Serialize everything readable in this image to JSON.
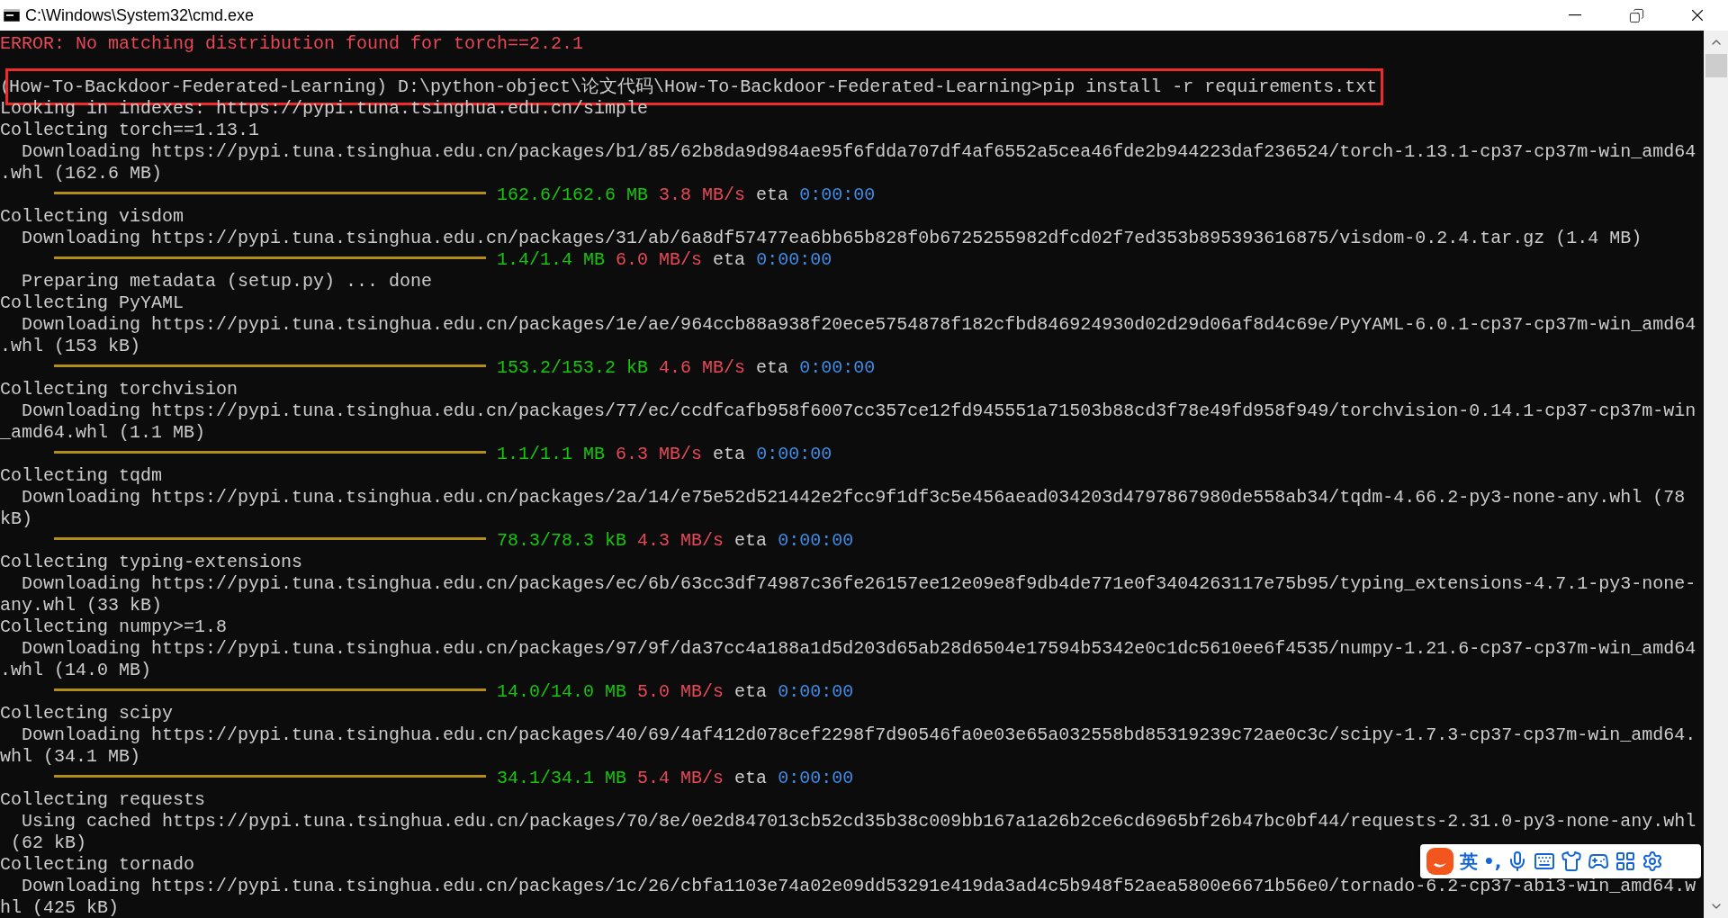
{
  "window": {
    "title": "C:\\Windows\\System32\\cmd.exe"
  },
  "console": {
    "rows": [
      {
        "kind": "text",
        "segments": [
          {
            "kind": "text",
            "text": "ERROR: No matching distribution found for torch==2.2.1",
            "color": "#e74856"
          }
        ]
      },
      {
        "kind": "blank"
      },
      {
        "kind": "text",
        "segments": [
          {
            "kind": "text",
            "text": "(",
            "color": "#cccccc"
          },
          {
            "kind": "text",
            "text": "How-To-Backdoor-Federated-Learning) D:\\python-object\\论文代码\\How-To-Backdoor-Federated-Learning>pip install -r requirements.txt",
            "color": "#cccccc",
            "boxed": true
          }
        ]
      },
      {
        "kind": "text",
        "segments": [
          {
            "kind": "text",
            "text": "Looking in indexes: https://pypi.tuna.tsinghua.edu.cn/simple",
            "color": "#cccccc"
          }
        ]
      },
      {
        "kind": "text",
        "segments": [
          {
            "kind": "text",
            "text": "Collecting torch==1.13.1",
            "color": "#cccccc"
          }
        ]
      },
      {
        "kind": "text",
        "segments": [
          {
            "kind": "text",
            "text": "  Downloading https://pypi.tuna.tsinghua.edu.cn/packages/b1/85/62b8da9d984ae95f6fdda707df4af6552a5cea46fde2b944223daf236524/torch-1.13.1-cp37-cp37m-win_amd64",
            "color": "#cccccc"
          }
        ]
      },
      {
        "kind": "text",
        "segments": [
          {
            "kind": "text",
            "text": ".whl (162.6 MB)",
            "color": "#cccccc"
          }
        ]
      },
      {
        "kind": "progress",
        "level": 1,
        "done": "162.6/162.6 MB",
        "speed": "3.8 MB/s",
        "eta_label": "eta",
        "eta": "0:00:00"
      },
      {
        "kind": "text",
        "segments": [
          {
            "kind": "text",
            "text": "Collecting visdom",
            "color": "#cccccc"
          }
        ]
      },
      {
        "kind": "text",
        "segments": [
          {
            "kind": "text",
            "text": "  Downloading https://pypi.tuna.tsinghua.edu.cn/packages/31/ab/6a8df57477ea6bb65b828f0b6725255982dfcd02f7ed353b895393616875/visdom-0.2.4.tar.gz (1.4 MB)",
            "color": "#cccccc"
          }
        ]
      },
      {
        "kind": "progress",
        "level": 1,
        "done": "1.4/1.4 MB",
        "speed": "6.0 MB/s",
        "eta_label": "eta",
        "eta": "0:00:00"
      },
      {
        "kind": "text",
        "segments": [
          {
            "kind": "text",
            "text": "  Preparing metadata (setup.py) ... done",
            "color": "#cccccc"
          }
        ]
      },
      {
        "kind": "text",
        "segments": [
          {
            "kind": "text",
            "text": "Collecting PyYAML",
            "color": "#cccccc"
          }
        ]
      },
      {
        "kind": "text",
        "segments": [
          {
            "kind": "text",
            "text": "  Downloading https://pypi.tuna.tsinghua.edu.cn/packages/1e/ae/964ccb88a938f20ece5754878f182cfbd846924930d02d29d06af8d4c69e/PyYAML-6.0.1-cp37-cp37m-win_amd64",
            "color": "#cccccc"
          }
        ]
      },
      {
        "kind": "text",
        "segments": [
          {
            "kind": "text",
            "text": ".whl (153 kB)",
            "color": "#cccccc"
          }
        ]
      },
      {
        "kind": "progress",
        "level": 1,
        "done": "153.2/153.2 kB",
        "speed": "4.6 MB/s",
        "eta_label": "eta",
        "eta": "0:00:00"
      },
      {
        "kind": "text",
        "segments": [
          {
            "kind": "text",
            "text": "Collecting torchvision",
            "color": "#cccccc"
          }
        ]
      },
      {
        "kind": "text",
        "segments": [
          {
            "kind": "text",
            "text": "  Downloading https://pypi.tuna.tsinghua.edu.cn/packages/77/ec/ccdfcafb958f6007cc357ce12fd945551a71503b88cd3f78e49fd958f949/torchvision-0.14.1-cp37-cp37m-win",
            "color": "#cccccc"
          }
        ]
      },
      {
        "kind": "text",
        "segments": [
          {
            "kind": "text",
            "text": "_amd64.whl (1.1 MB)",
            "color": "#cccccc"
          }
        ]
      },
      {
        "kind": "progress",
        "level": 1,
        "done": "1.1/1.1 MB",
        "speed": "6.3 MB/s",
        "eta_label": "eta",
        "eta": "0:00:00"
      },
      {
        "kind": "text",
        "segments": [
          {
            "kind": "text",
            "text": "Collecting tqdm",
            "color": "#cccccc"
          }
        ]
      },
      {
        "kind": "text",
        "segments": [
          {
            "kind": "text",
            "text": "  Downloading https://pypi.tuna.tsinghua.edu.cn/packages/2a/14/e75e52d521442e2fcc9f1df3c5e456aead034203d4797867980de558ab34/tqdm-4.66.2-py3-none-any.whl (78",
            "color": "#cccccc"
          }
        ]
      },
      {
        "kind": "text",
        "segments": [
          {
            "kind": "text",
            "text": "kB)",
            "color": "#cccccc"
          }
        ]
      },
      {
        "kind": "progress",
        "level": 1,
        "done": "78.3/78.3 kB",
        "speed": "4.3 MB/s",
        "eta_label": "eta",
        "eta": "0:00:00"
      },
      {
        "kind": "text",
        "segments": [
          {
            "kind": "text",
            "text": "Collecting typing-extensions",
            "color": "#cccccc"
          }
        ]
      },
      {
        "kind": "text",
        "segments": [
          {
            "kind": "text",
            "text": "  Downloading https://pypi.tuna.tsinghua.edu.cn/packages/ec/6b/63cc3df74987c36fe26157ee12e09e8f9db4de771e0f3404263117e75b95/typing_extensions-4.7.1-py3-none-",
            "color": "#cccccc"
          }
        ]
      },
      {
        "kind": "text",
        "segments": [
          {
            "kind": "text",
            "text": "any.whl (33 kB)",
            "color": "#cccccc"
          }
        ]
      },
      {
        "kind": "text",
        "segments": [
          {
            "kind": "text",
            "text": "Collecting numpy>=1.8",
            "color": "#cccccc"
          }
        ]
      },
      {
        "kind": "text",
        "segments": [
          {
            "kind": "text",
            "text": "  Downloading https://pypi.tuna.tsinghua.edu.cn/packages/97/9f/da37cc4a188a1d5d203d65ab28d6504e17594b5342e0c1dc5610ee6f4535/numpy-1.21.6-cp37-cp37m-win_amd64",
            "color": "#cccccc"
          }
        ]
      },
      {
        "kind": "text",
        "segments": [
          {
            "kind": "text",
            "text": ".whl (14.0 MB)",
            "color": "#cccccc"
          }
        ]
      },
      {
        "kind": "progress",
        "level": 1,
        "done": "14.0/14.0 MB",
        "speed": "5.0 MB/s",
        "eta_label": "eta",
        "eta": "0:00:00"
      },
      {
        "kind": "text",
        "segments": [
          {
            "kind": "text",
            "text": "Collecting scipy",
            "color": "#cccccc"
          }
        ]
      },
      {
        "kind": "text",
        "segments": [
          {
            "kind": "text",
            "text": "  Downloading https://pypi.tuna.tsinghua.edu.cn/packages/40/69/4af412d078cef2298f7d90546fa0e03e65a032558bd85319239c72ae0c3c/scipy-1.7.3-cp37-cp37m-win_amd64.",
            "color": "#cccccc"
          }
        ]
      },
      {
        "kind": "text",
        "segments": [
          {
            "kind": "text",
            "text": "whl (34.1 MB)",
            "color": "#cccccc"
          }
        ]
      },
      {
        "kind": "progress",
        "level": 1,
        "done": "34.1/34.1 MB",
        "speed": "5.4 MB/s",
        "eta_label": "eta",
        "eta": "0:00:00"
      },
      {
        "kind": "text",
        "segments": [
          {
            "kind": "text",
            "text": "Collecting requests",
            "color": "#cccccc"
          }
        ]
      },
      {
        "kind": "text",
        "segments": [
          {
            "kind": "text",
            "text": "  Using cached https://pypi.tuna.tsinghua.edu.cn/packages/70/8e/0e2d847013cb52cd35b38c009bb167a1a26b2ce6cd6965bf26b47bc0bf44/requests-2.31.0-py3-none-any.whl",
            "color": "#cccccc"
          }
        ]
      },
      {
        "kind": "text",
        "segments": [
          {
            "kind": "text",
            "text": " (62 kB)",
            "color": "#cccccc"
          }
        ]
      },
      {
        "kind": "text",
        "segments": [
          {
            "kind": "text",
            "text": "Collecting tornado",
            "color": "#cccccc"
          }
        ]
      },
      {
        "kind": "text",
        "segments": [
          {
            "kind": "text",
            "text": "  Downloading https://pypi.tuna.tsinghua.edu.cn/packages/1c/26/cbfa1103e74a02e09dd53291e419da3ad4c5b948f52aea5800e6671b56e0/tornado-6.2-cp37-abi3-win_amd64.w",
            "color": "#cccccc"
          }
        ]
      },
      {
        "kind": "text",
        "segments": [
          {
            "kind": "text",
            "text": "hl (425 kB)",
            "color": "#cccccc"
          }
        ]
      }
    ]
  },
  "ime_toolbar": {
    "language": "英",
    "punctuation": "•,"
  }
}
